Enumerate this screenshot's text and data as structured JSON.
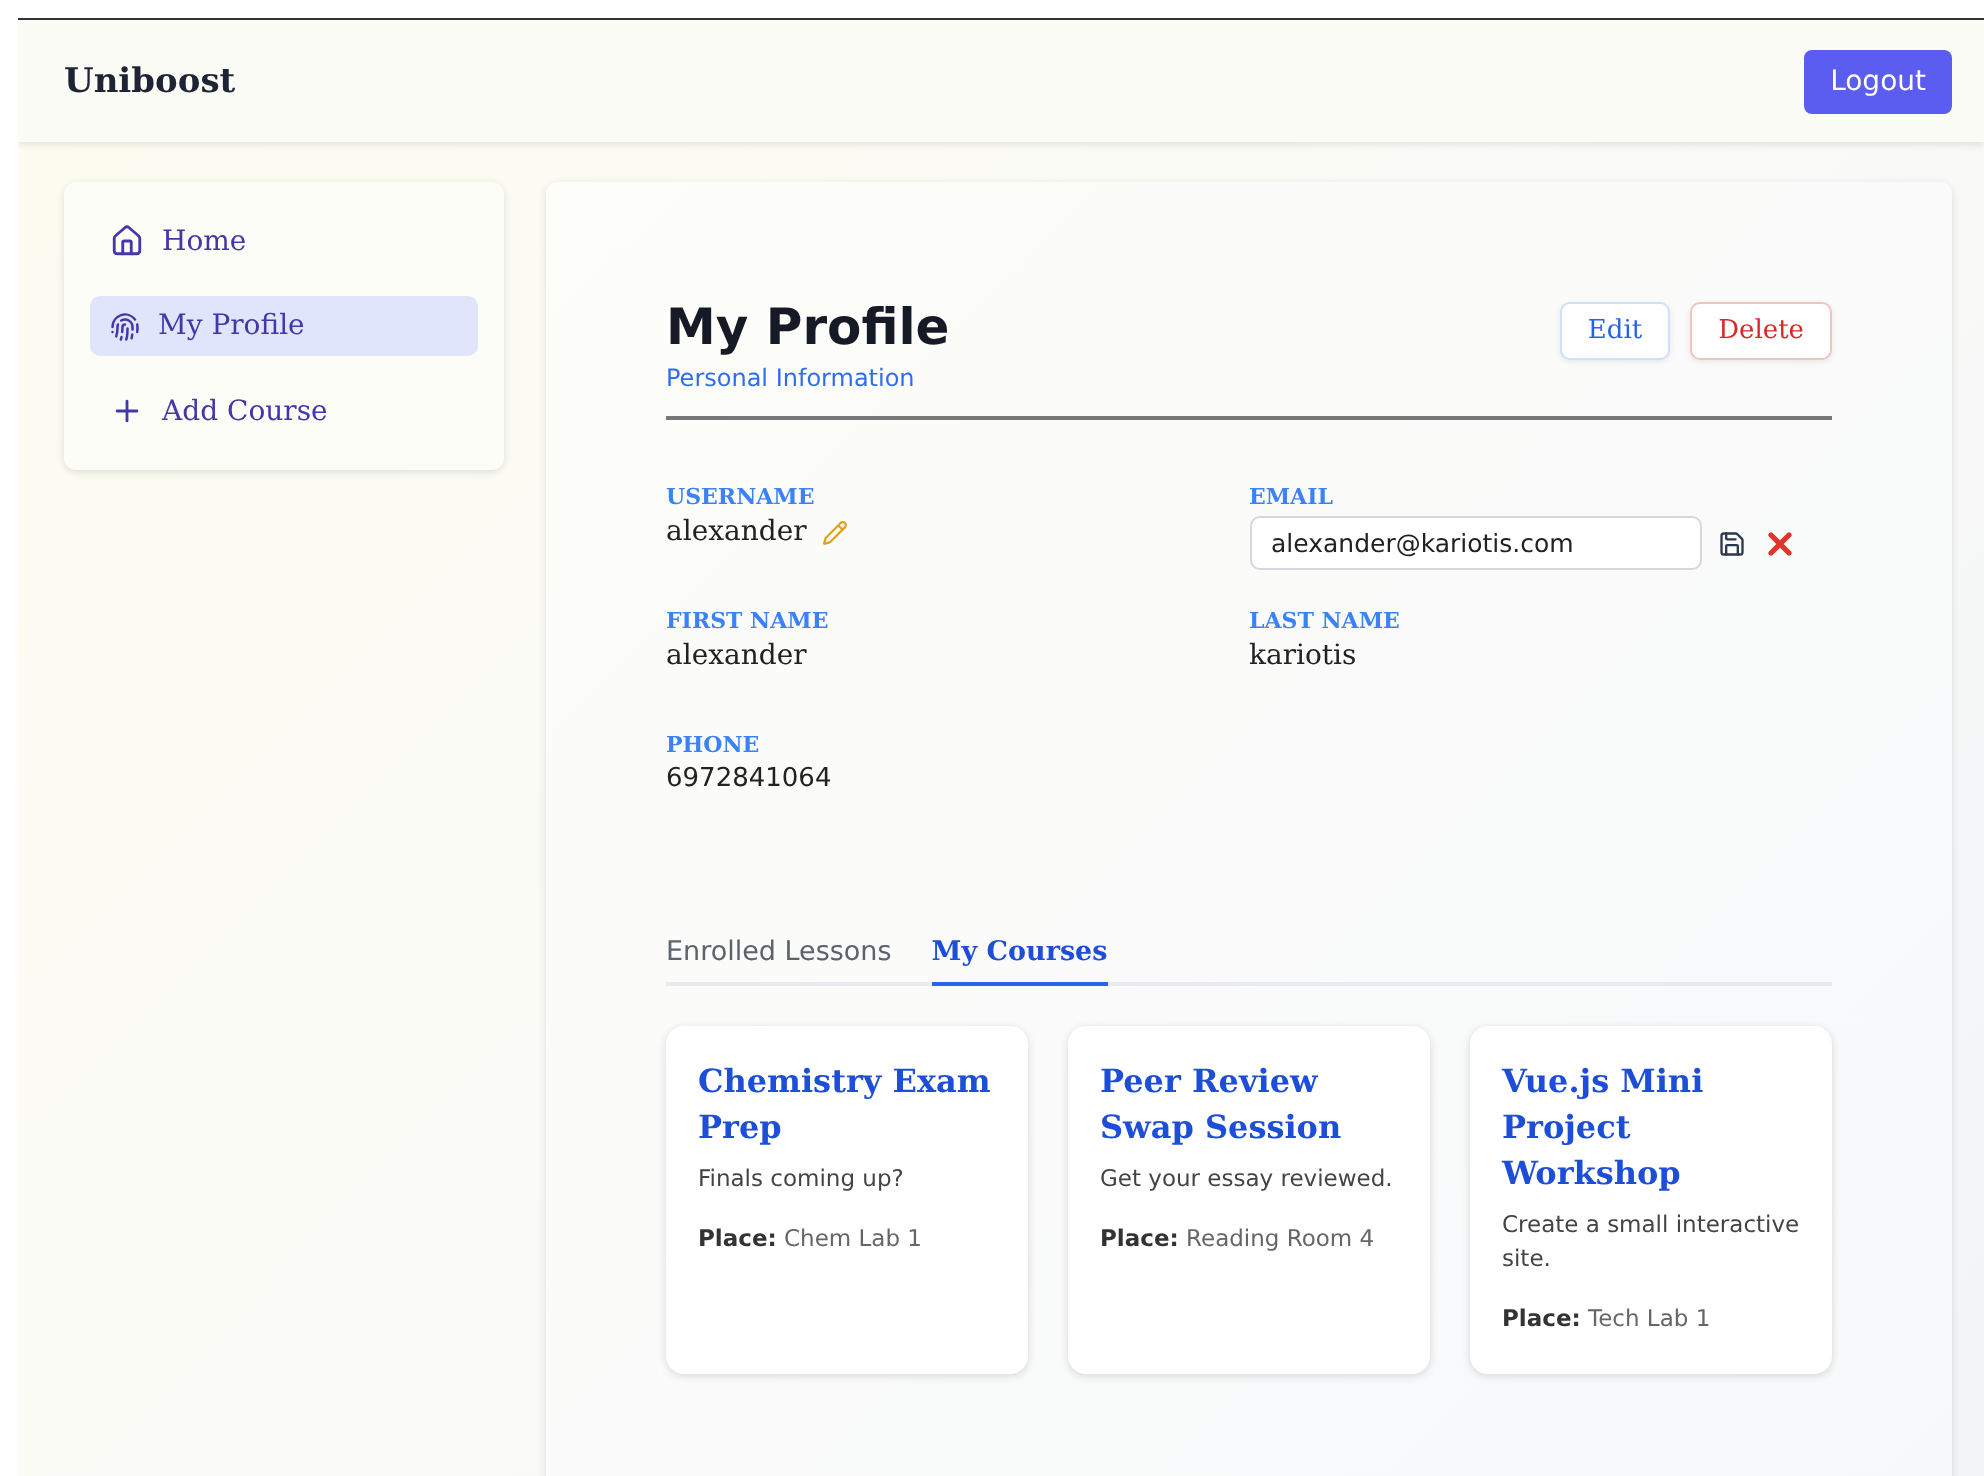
{
  "brand": "Uniboost",
  "logout": "Logout",
  "nav": [
    {
      "label": "Home",
      "kind": "home",
      "selected": false
    },
    {
      "label": "My Profile",
      "kind": "profile",
      "selected": true
    },
    {
      "label": "Add Course",
      "kind": "add",
      "selected": false
    }
  ],
  "profile": {
    "title": "My Profile",
    "subtitle": "Personal Information",
    "edit": "Edit",
    "delete": "Delete",
    "fields": [
      {
        "label": "USERNAME",
        "value": "alexander",
        "kind": "editable"
      },
      {
        "label": "EMAIL",
        "value": "alexander@kariotis.com",
        "kind": "input"
      },
      {
        "label": "FIRST NAME",
        "value": "alexander",
        "kind": "text"
      },
      {
        "label": "LAST NAME",
        "value": "kariotis",
        "kind": "text"
      },
      {
        "label": "PHONE",
        "value": "6972841064",
        "kind": "number"
      }
    ]
  },
  "tabs": [
    {
      "label": "Enrolled Lessons",
      "selected": false
    },
    {
      "label": "My Courses",
      "selected": true
    }
  ],
  "courses": [
    {
      "title": "Chemistry Exam Prep",
      "description": "Finals coming up?",
      "place": "**Place:** Chem Lab 1"
    },
    {
      "title": "Peer Review Swap Session",
      "description": "Get your essay reviewed.",
      "place": "**Place:** Reading Room 4"
    },
    {
      "title": "Vue.js Mini Project Workshop",
      "description": "Create a small interactive site.",
      "place": "**Place:** Tech Lab 1"
    }
  ]
}
